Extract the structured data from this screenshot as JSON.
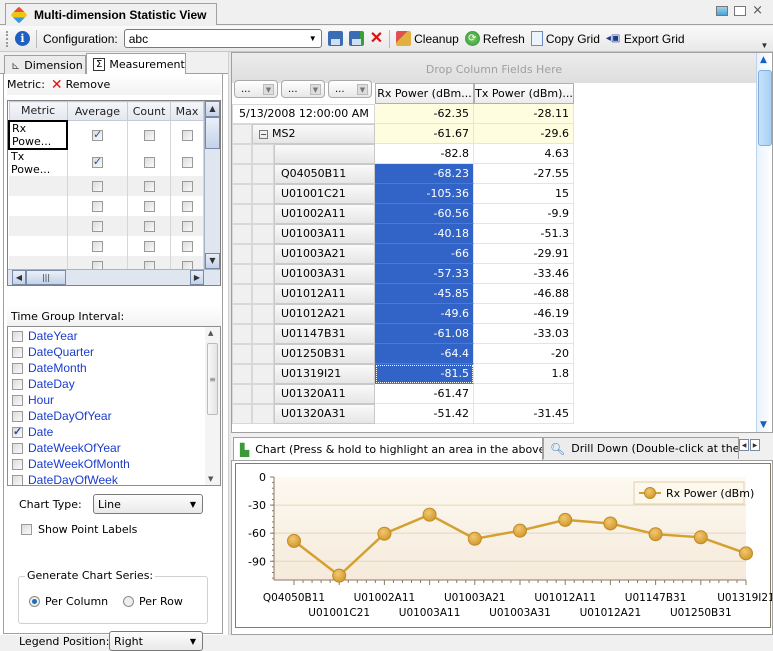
{
  "window": {
    "title": "Multi-dimension Statistic View",
    "app_icon": "cube-icon",
    "controls": [
      "restore-icon",
      "maximize-icon",
      "close-icon"
    ]
  },
  "toolbar": {
    "info_icon": "info-icon",
    "configuration_label": "Configuration:",
    "configuration_value": "abc",
    "save_icon": "save-icon",
    "save_as_icon": "save-as-icon",
    "delete_icon": "delete-icon",
    "cleanup_label": "Cleanup",
    "refresh_label": "Refresh",
    "copy_grid_label": "Copy Grid",
    "export_grid_label": "Export Grid"
  },
  "left_tabs": [
    {
      "label": "Dimension",
      "icon": "axis-icon",
      "active": false
    },
    {
      "label": "Measurement",
      "icon": "sigma-icon",
      "active": true
    }
  ],
  "metric": {
    "label": "Metric:",
    "remove_label": "Remove",
    "columns": [
      "Metric",
      "Average",
      "Count",
      "Max"
    ],
    "rows": [
      {
        "name": "Rx Powe...",
        "average": true,
        "count": false,
        "max": false
      },
      {
        "name": "Tx Powe...",
        "average": true,
        "count": false,
        "max": false
      },
      {
        "name": "",
        "average": false,
        "count": false,
        "max": false
      },
      {
        "name": "",
        "average": false,
        "count": false,
        "max": false
      },
      {
        "name": "",
        "average": false,
        "count": false,
        "max": false
      },
      {
        "name": "",
        "average": false,
        "count": false,
        "max": false
      },
      {
        "name": "",
        "average": false,
        "count": false,
        "max": false
      }
    ]
  },
  "time_group": {
    "label": "Time Group Interval:",
    "items": [
      {
        "label": "DateYear",
        "checked": false
      },
      {
        "label": "DateQuarter",
        "checked": false
      },
      {
        "label": "DateMonth",
        "checked": false
      },
      {
        "label": "DateDay",
        "checked": false
      },
      {
        "label": "Hour",
        "checked": false
      },
      {
        "label": "DateDayOfYear",
        "checked": false
      },
      {
        "label": "Date",
        "checked": true
      },
      {
        "label": "DateWeekOfYear",
        "checked": false
      },
      {
        "label": "DateWeekOfMonth",
        "checked": false
      },
      {
        "label": "DateDayOfWeek",
        "checked": false
      }
    ]
  },
  "chart_options": {
    "chart_type_label": "Chart Type:",
    "chart_type_value": "Line",
    "show_point_labels_label": "Show Point Labels",
    "show_point_labels": false,
    "generate_series_label": "Generate Chart Series:",
    "per_column_label": "Per Column",
    "per_row_label": "Per Row",
    "selected_series_mode": "Per Column",
    "legend_position_label": "Legend Position:",
    "legend_position_value": "Right"
  },
  "pivot": {
    "drop_column_hint": "Drop Column Fields Here",
    "field_buttons": [
      "...",
      "...",
      "..."
    ],
    "columns": [
      "Rx Power (dBm...",
      "Tx Power (dBm)..."
    ],
    "date_row": {
      "label": "5/13/2008 12:00:00 AM",
      "rx": "-62.35",
      "tx": "-28.11"
    },
    "group_row": {
      "label": "MS2",
      "rx": "-61.67",
      "tx": "-29.6"
    },
    "rows": [
      {
        "label": "",
        "rx": "-82.8",
        "tx": "4.63",
        "selected": false
      },
      {
        "label": "Q04050B11",
        "rx": "-68.23",
        "tx": "-27.55",
        "selected": true
      },
      {
        "label": "U01001C21",
        "rx": "-105.36",
        "tx": "15",
        "selected": true
      },
      {
        "label": "U01002A11",
        "rx": "-60.56",
        "tx": "-9.9",
        "selected": true
      },
      {
        "label": "U01003A11",
        "rx": "-40.18",
        "tx": "-51.3",
        "selected": true
      },
      {
        "label": "U01003A21",
        "rx": "-66",
        "tx": "-29.91",
        "selected": true
      },
      {
        "label": "U01003A31",
        "rx": "-57.33",
        "tx": "-33.46",
        "selected": true
      },
      {
        "label": "U01012A11",
        "rx": "-45.85",
        "tx": "-46.88",
        "selected": true
      },
      {
        "label": "U01012A21",
        "rx": "-49.6",
        "tx": "-46.19",
        "selected": true
      },
      {
        "label": "U01147B31",
        "rx": "-61.08",
        "tx": "-33.03",
        "selected": true
      },
      {
        "label": "U01250B31",
        "rx": "-64.4",
        "tx": "-20",
        "selected": true
      },
      {
        "label": "U01319I21",
        "rx": "-81.5",
        "tx": "1.8",
        "selected": true,
        "focused": true
      },
      {
        "label": "U01320A11",
        "rx": "-61.47",
        "tx": "",
        "selected": false
      },
      {
        "label": "U01320A31",
        "rx": "-51.42",
        "tx": "-31.45",
        "selected": false
      }
    ]
  },
  "bottom_tabs": [
    {
      "label": "Chart (Press & hold to highlight an area in the above grid)",
      "icon": "chart-icon",
      "active": true
    },
    {
      "label": "Drill Down (Double-click at the abov",
      "icon": "magnifier-icon",
      "active": false
    }
  ],
  "chart_data": {
    "type": "line",
    "title": "",
    "xlabel": "",
    "ylabel": "",
    "categories": [
      "Q04050B11",
      "U01001C21",
      "U01002A11",
      "U01003A11",
      "U01003A21",
      "U01003A31",
      "U01012A11",
      "U01012A21",
      "U01147B31",
      "U01250B31",
      "U01319I21"
    ],
    "series": [
      {
        "name": "Rx Power (dBm)",
        "values": [
          -68.23,
          -105.36,
          -60.56,
          -40.18,
          -66,
          -57.33,
          -45.85,
          -49.6,
          -61.08,
          -64.4,
          -81.5
        ],
        "color": "#d4a030"
      }
    ],
    "ylim": [
      -110,
      0
    ],
    "yticks": [
      0,
      -30,
      -60,
      -90
    ],
    "grid": true,
    "legend": "top-right"
  }
}
